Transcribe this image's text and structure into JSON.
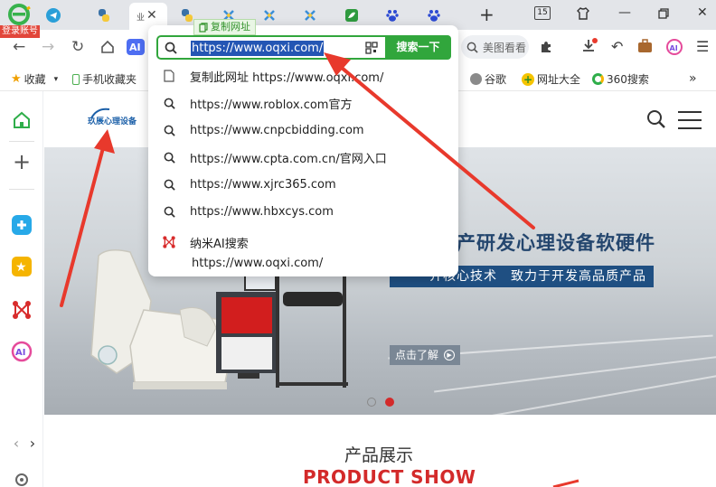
{
  "tabs": {
    "login_tag": "登录账号",
    "active_tab_label": "业",
    "tab_count": "15"
  },
  "toolbar": {
    "right_search_placeholder": "美图看看"
  },
  "bookmarks": [
    {
      "label": "收藏",
      "icon": "star-icon"
    },
    {
      "label": "手机收藏夹",
      "icon": "phone-icon"
    },
    {
      "label": "谷歌",
      "icon": "globe-icon"
    },
    {
      "label": "网址大全",
      "icon": "plus-circle-icon"
    },
    {
      "label": "360搜索",
      "icon": "360-search-icon"
    }
  ],
  "omnibox": {
    "copy_tip": "复制网址",
    "url": "https://www.oqxi.com/",
    "search_button": "搜索一下",
    "suggestions": [
      {
        "text": "复制此网址 https://www.oqxi.com/",
        "icon": "page-icon"
      },
      {
        "text": "https://www.roblox.com官方",
        "icon": "search-icon"
      },
      {
        "text": "https://www.cnpcbidding.com",
        "icon": "search-icon"
      },
      {
        "text": "https://www.cpta.com.cn/官网入口",
        "icon": "search-icon"
      },
      {
        "text": "https://www.xjrc365.com",
        "icon": "search-icon"
      },
      {
        "text": "https://www.hbxcys.com",
        "icon": "search-icon"
      }
    ],
    "nami": {
      "title": "纳米AI搜索",
      "subtitle": "https://www.oqxi.com/"
    }
  },
  "page": {
    "logo_text": "玖辰心理设备",
    "headline": "产研发心理设备软硬件",
    "subline": "介核心技术　致力于开发高品质产品",
    "more_button": "点击了解",
    "section_title_cn": "产品展示",
    "section_title_en": "PRODUCT SHOW"
  },
  "colors": {
    "accent_green": "#31a63c",
    "selection_blue": "#2456b4",
    "annotation_red": "#e8392c",
    "banner_navy": "#1f4f82",
    "product_red": "#d32a2a"
  }
}
